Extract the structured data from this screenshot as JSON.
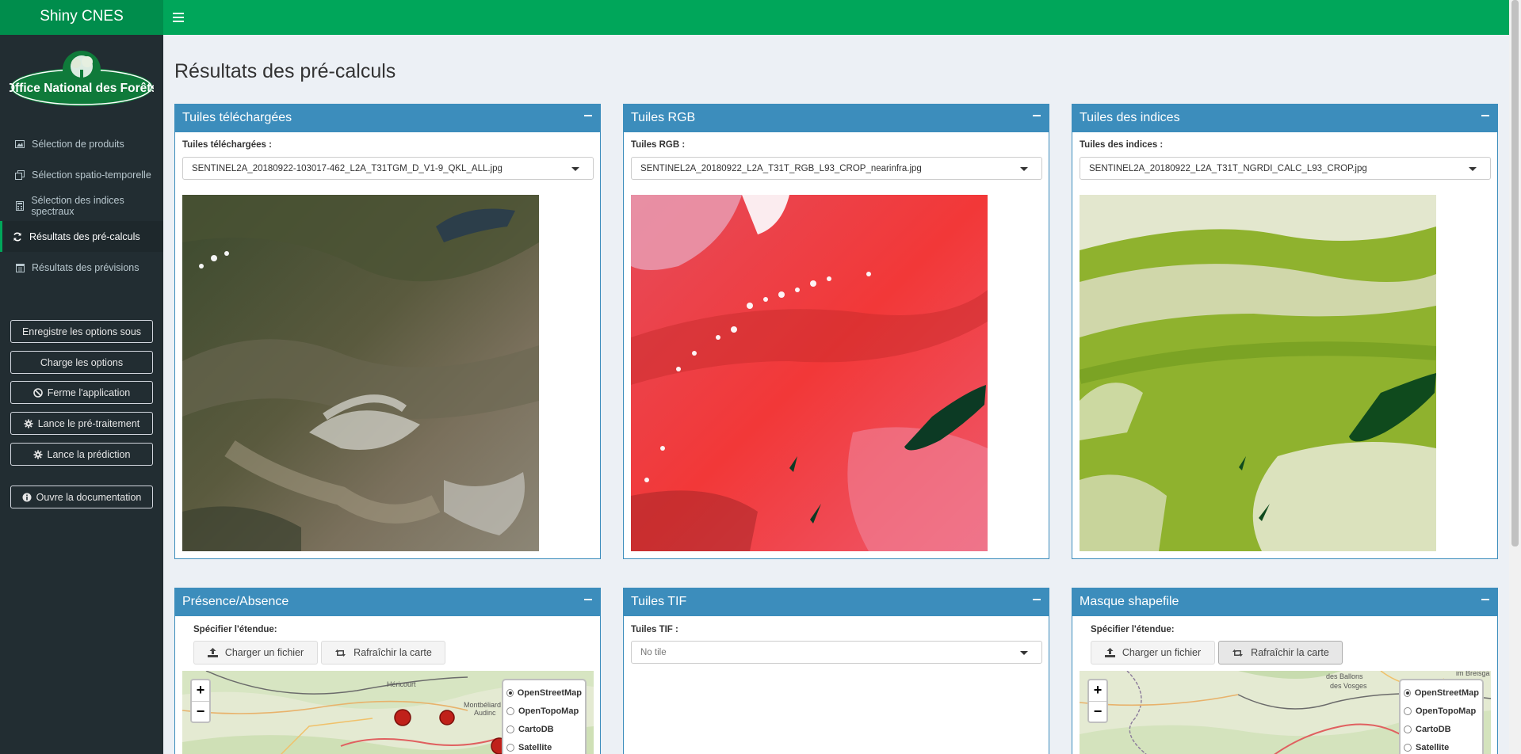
{
  "app": {
    "title": "Shiny CNES"
  },
  "logo": {
    "text": "Office National des Forêts"
  },
  "sidebar": {
    "items": [
      {
        "label": "Sélection de produits",
        "icon": "image-icon"
      },
      {
        "label": "Sélection spatio-temporelle",
        "icon": "copy-icon"
      },
      {
        "label": "Sélection des indices spectraux",
        "icon": "calculator-icon"
      },
      {
        "label": "Résultats des pré-calculs",
        "icon": "refresh-icon",
        "active": true
      },
      {
        "label": "Résultats des prévisions",
        "icon": "calendar-icon"
      }
    ],
    "buttons": {
      "save": "Enregistre les options sous",
      "load": "Charge les options",
      "close": "Ferme l'application",
      "preprocess": "Lance le pré-traitement",
      "predict": "Lance la prédiction",
      "docs": "Ouvre la documentation"
    }
  },
  "page": {
    "title": "Résultats des pré-calculs"
  },
  "boxes": {
    "downloaded": {
      "title": "Tuiles téléchargées",
      "label": "Tuiles téléchargées :",
      "value": "SENTINEL2A_20180922-103017-462_L2A_T31TGM_D_V1-9_QKL_ALL.jpg"
    },
    "rgb": {
      "title": "Tuiles RGB",
      "label": "Tuiles RGB :",
      "value": "SENTINEL2A_20180922_L2A_T31T_RGB_L93_CROP_nearinfra.jpg"
    },
    "indices": {
      "title": "Tuiles des indices",
      "label": "Tuiles des indices :",
      "value": "SENTINEL2A_20180922_L2A_T31T_NGRDI_CALC_L93_CROP.jpg"
    },
    "presence": {
      "title": "Présence/Absence",
      "extent_label": "Spécifier l'étendue:",
      "upload": "Charger un fichier",
      "refresh": "Rafraîchir la carte",
      "map_labels": [
        "Héricourt",
        "Montbéliard",
        "Audinc"
      ]
    },
    "tif": {
      "title": "Tuiles TIF",
      "label": "Tuiles TIF :",
      "value": "No tile"
    },
    "shapefile": {
      "title": "Masque shapefile",
      "extent_label": "Spécifier l'étendue:",
      "upload": "Charger un fichier",
      "refresh": "Rafraîchir la carte",
      "map_labels": [
        "des Ballons",
        "des Vosges",
        "im Breisga"
      ]
    }
  },
  "map_layers": [
    "OpenStreetMap",
    "OpenTopoMap",
    "CartoDB",
    "Satellite"
  ],
  "map_layers_selected": "OpenStreetMap",
  "zoom": {
    "in": "+",
    "out": "−"
  },
  "colors": {
    "header": "#00a65a",
    "logo_bg": "#008d4c",
    "sidebar": "#222d32",
    "box_header": "#3c8dbc",
    "marker": "#c0211a"
  }
}
